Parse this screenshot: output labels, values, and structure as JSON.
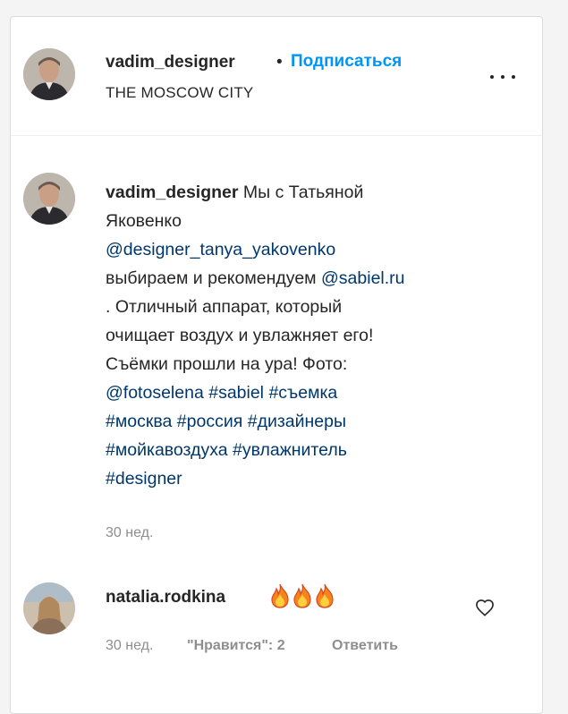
{
  "header": {
    "username": "vadim_designer",
    "separator": "•",
    "follow_label": "Подписаться",
    "location": "THE MOSCOW CITY",
    "more_icon": "more-horizontal-icon"
  },
  "caption": {
    "username": "vadim_designer",
    "lines": [
      {
        "text": " Мы с Татьяной"
      },
      {
        "text": "Яковенко"
      },
      {
        "mention": "@designer_tanya_yakovenko"
      },
      {
        "text": "выбираем и рекомендуем ",
        "mention": "@sabiel.ru"
      },
      {
        "text": ". Отличный аппарат, который"
      },
      {
        "text": "очищает воздух и увлажняет его!"
      },
      {
        "text": "Съёмки прошли на ура! Фото:"
      },
      {
        "tags": [
          "@fotoselena",
          "#sabiel",
          "#съемка"
        ]
      },
      {
        "tags": [
          "#москва",
          "#россия",
          "#дизайнеры"
        ]
      },
      {
        "tags": [
          "#мойкавоздуха",
          "#увлажнитель"
        ]
      },
      {
        "tags": [
          "#designer"
        ]
      }
    ],
    "time": "30 нед."
  },
  "comment": {
    "username": "natalia.rodkina",
    "emoji": "fire-icon x3",
    "time": "30 нед.",
    "likes": "\"Нравится\": 2",
    "reply_label": "Ответить",
    "like_icon": "heart-outline-icon"
  },
  "colors": {
    "link_blue": "#0095f6",
    "tag_blue": "#00376b",
    "muted": "#8e8e8e",
    "text": "#262626"
  }
}
